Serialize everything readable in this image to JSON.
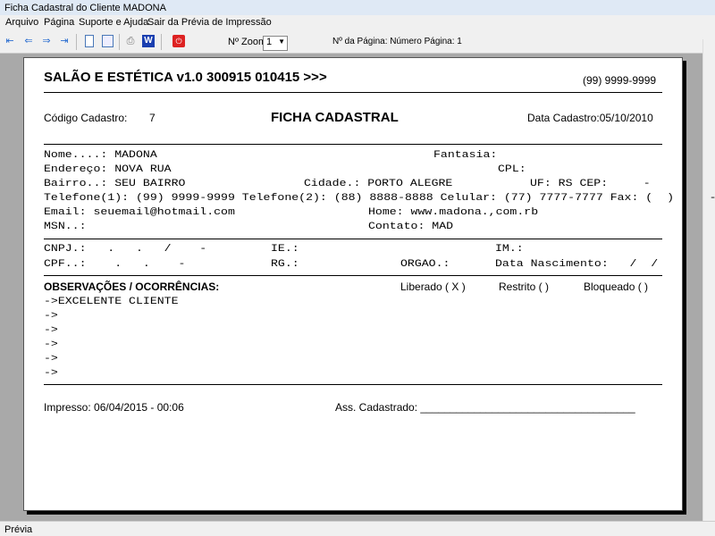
{
  "window": {
    "title": "Ficha Cadastral do Cliente MADONA"
  },
  "menu": [
    "Arquivo",
    "Página",
    "Suporte e Ajuda",
    "Sair da Prévia de Impressão"
  ],
  "toolbar": {
    "zoom_label": "Nº Zoom",
    "zoom_value": "1",
    "page_label": "Nº da Página: Número Página: 1"
  },
  "report": {
    "company": "SALÃO E ESTÉTICA v1.0 300915 010415 >>>",
    "phone": "(99) 9999-9999",
    "codigo_label": "Código Cadastro:",
    "codigo": "7",
    "title": "FICHA CADASTRAL",
    "data_cadastro": "Data Cadastro:05/10/2010",
    "nome": "Nome....: MADONA",
    "fantasia": "Fantasia:",
    "endereco": "Endereço: NOVA RUA",
    "cpl": "CPL:",
    "bairro": "Bairro..: SEU BAIRRO",
    "cidade": "Cidade.: PORTO ALEGRE",
    "uf": "UF: RS CEP:     -",
    "telefones": "Telefone(1): (99) 9999-9999 Telefone(2): (88) 8888-8888 Celular: (77) 7777-7777 Fax: (  )     -",
    "email": "Email: seuemail@hotmail.com",
    "home": "Home: www.madona.,com.rb",
    "msn": "MSN..:",
    "contato": "Contato: MAD",
    "cnpj": "CNPJ.:   .   .   /    -",
    "ie": "IE.:",
    "im": "IM.:",
    "cpf": "CPF..:    .   .    -",
    "rg": "RG.:",
    "orgao": "ORGAO.:",
    "nascimento": "Data Nascimento:   /  /",
    "obs_title": "OBSERVAÇÕES / OCORRÊNCIAS:",
    "liberado": "Liberado ( X )",
    "restrito": "Restrito (  )",
    "bloqueado": "Bloqueado (  )",
    "obs_lines": [
      "->EXCELENTE CLIENTE",
      "->",
      "->",
      "->",
      "->",
      "->"
    ],
    "impresso": "Impresso: 06/04/2015 - 00:06",
    "assinatura": "Ass. Cadastrado: ____________________________________"
  },
  "status": "Prévia"
}
